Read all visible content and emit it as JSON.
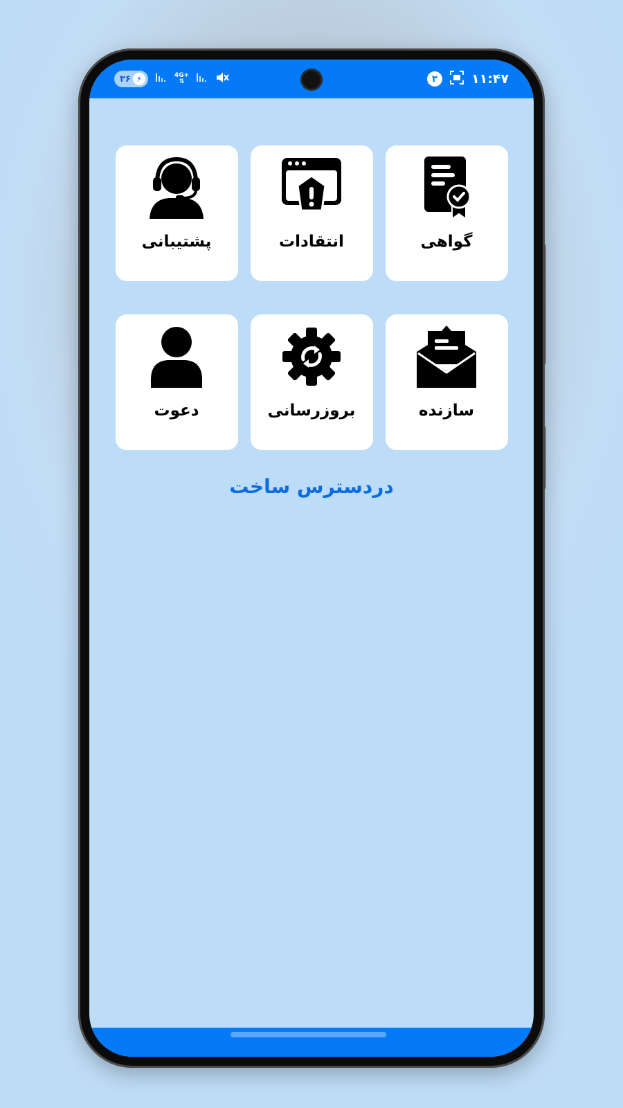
{
  "status_bar": {
    "time": "۱۱:۴۷",
    "notification_count": "۳",
    "battery_level": "۳۶",
    "network_type": "4G+"
  },
  "tiles": [
    {
      "label": "گواهی",
      "icon": "certificate-icon"
    },
    {
      "label": "انتقادات",
      "icon": "feedback-warning-icon"
    },
    {
      "label": "پشتیبانی",
      "icon": "support-headset-icon"
    },
    {
      "label": "سازنده",
      "icon": "envelope-letter-icon"
    },
    {
      "label": "بروزرسانی",
      "icon": "update-gear-icon"
    },
    {
      "label": "دعوت",
      "icon": "user-icon"
    }
  ],
  "main": {
    "title": "دردسترس ساخت"
  },
  "colors": {
    "accent": "#057af9",
    "background": "#bcdcf7",
    "title": "#0b6cdf"
  }
}
